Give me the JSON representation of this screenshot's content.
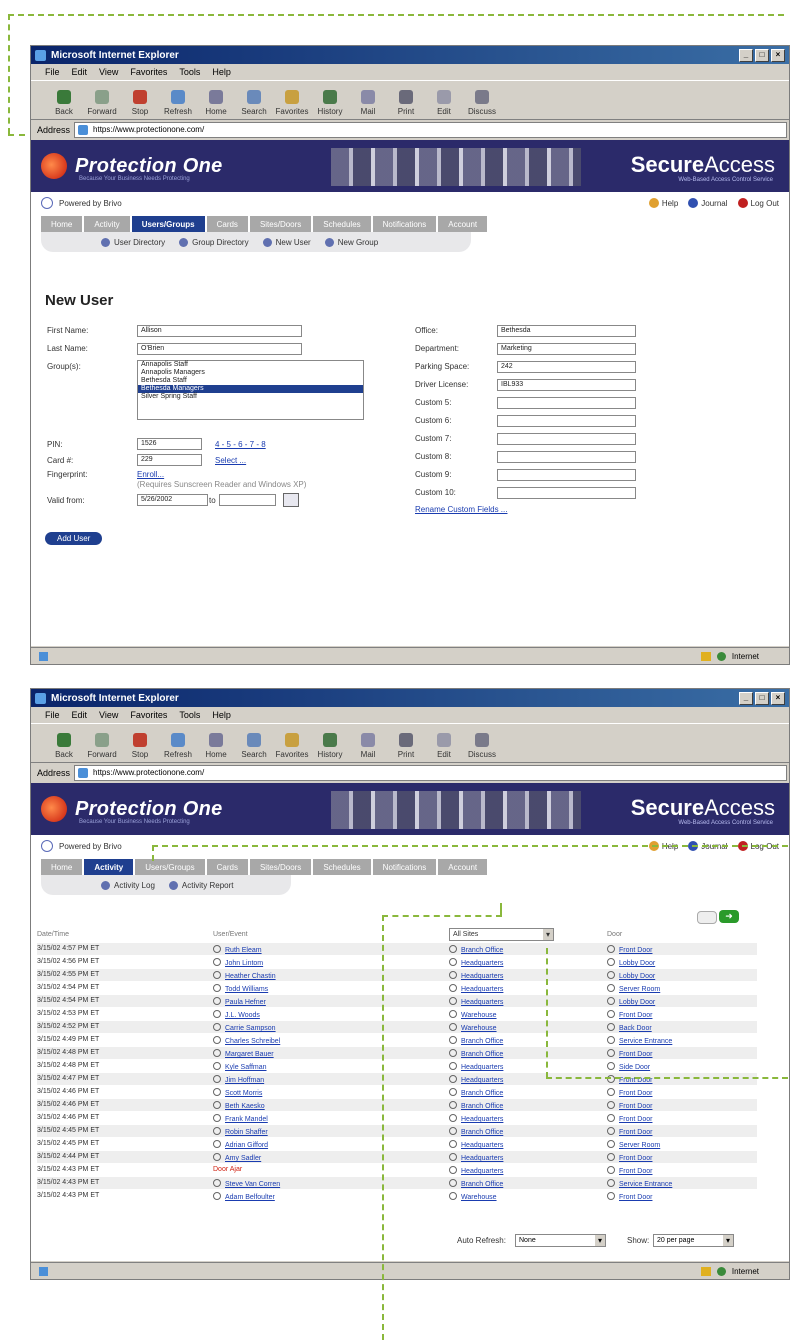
{
  "accent": "#8ab83c",
  "browser": {
    "title": "Microsoft Internet Explorer",
    "menu": [
      "File",
      "Edit",
      "View",
      "Favorites",
      "Tools",
      "Help"
    ],
    "toolbar": [
      "Back",
      "Forward",
      "Stop",
      "Refresh",
      "Home",
      "Search",
      "Favorites",
      "History",
      "Mail",
      "Print",
      "Edit",
      "Discuss"
    ],
    "address_label": "Address",
    "url_top": "https://www.protectionone.com/",
    "url_bottom": "https://www.protectionone.com/",
    "status_zone": "Internet"
  },
  "banner": {
    "brand": "Protection One",
    "tagline": "Because Your Business Needs Protecting",
    "product_bold": "Secure",
    "product_rest": "Access",
    "product_sub": "Web-Based Access Control Service"
  },
  "powered_by": "Powered by Brivo",
  "util": {
    "help": "Help",
    "journal": "Journal",
    "logout": "Log Out"
  },
  "tabs": [
    "Home",
    "Activity",
    "Users/Groups",
    "Cards",
    "Sites/Doors",
    "Schedules",
    "Notifications",
    "Account"
  ],
  "users_subnav": [
    "User Directory",
    "Group Directory",
    "New User",
    "New Group"
  ],
  "activity_subnav": [
    "Activity Log",
    "Activity Report"
  ],
  "new_user": {
    "heading": "New User",
    "first_name_label": "First Name:",
    "first_name": "Allison",
    "last_name_label": "Last Name:",
    "last_name": "O'Brien",
    "groups_label": "Group(s):",
    "groups": [
      "Annapolis Staff",
      "Annapolis Managers",
      "Bethesda Staff",
      "Bethesda Managers",
      "Silver Spring Staff"
    ],
    "selected_group": "Bethesda Managers",
    "pin_label": "PIN:",
    "pin": "1526",
    "pin_links": "4 - 5 - 6 - 7 - 8",
    "card_label": "Card #:",
    "card": "229",
    "card_link": "Select ...",
    "fingerprint_label": "Fingerprint:",
    "fingerprint_link": "Enroll...",
    "fingerprint_note": "(Requires Sunscreen Reader and Windows XP)",
    "valid_from_label": "Valid from:",
    "valid_from": "5/26/2002",
    "valid_to_label": "to",
    "office_label": "Office:",
    "office": "Bethesda",
    "department_label": "Department:",
    "department": "Marketing",
    "parking_label": "Parking Space:",
    "parking": "242",
    "license_label": "Driver License:",
    "license": "IBL933",
    "custom_labels": [
      "Custom 5:",
      "Custom 6:",
      "Custom 7:",
      "Custom 8:",
      "Custom 9:",
      "Custom 10:"
    ],
    "rename_link": "Rename Custom Fields ...",
    "add_button": "Add User"
  },
  "activity": {
    "col_datetime": "Date/Time",
    "col_user": "User/Event",
    "col_site_filter": "All Sites",
    "col_door": "Door",
    "rows": [
      {
        "dt": "3/15/02 4:57 PM ET",
        "user": "Ruth Eleam",
        "site": "Branch Office",
        "door": "Front Door"
      },
      {
        "dt": "3/15/02 4:56 PM ET",
        "user": "John Lintom",
        "site": "Headquarters",
        "door": "Lobby Door"
      },
      {
        "dt": "3/15/02 4:55 PM ET",
        "user": "Heather Chastin",
        "site": "Headquarters",
        "door": "Lobby Door"
      },
      {
        "dt": "3/15/02 4:54 PM ET",
        "user": "Todd Williams",
        "site": "Headquarters",
        "door": "Server Room"
      },
      {
        "dt": "3/15/02 4:54 PM ET",
        "user": "Paula Hefner",
        "site": "Headquarters",
        "door": "Lobby Door"
      },
      {
        "dt": "3/15/02 4:53 PM ET",
        "user": "J.L. Woods",
        "site": "Warehouse",
        "door": "Front Door"
      },
      {
        "dt": "3/15/02 4:52 PM ET",
        "user": "Carrie Sampson",
        "site": "Warehouse",
        "door": "Back Door"
      },
      {
        "dt": "3/15/02 4:49 PM ET",
        "user": "Charles Schreibel",
        "site": "Branch Office",
        "door": "Service Entrance"
      },
      {
        "dt": "3/15/02 4:48 PM ET",
        "user": "Margaret Bauer",
        "site": "Branch Office",
        "door": "Front Door"
      },
      {
        "dt": "3/15/02 4:48 PM ET",
        "user": "Kyle Saffman",
        "site": "Headquarters",
        "door": "Side Door"
      },
      {
        "dt": "3/15/02 4:47 PM ET",
        "user": "Jim Hoffman",
        "site": "Headquarters",
        "door": "Front Door"
      },
      {
        "dt": "3/15/02 4:46 PM ET",
        "user": "Scott Morris",
        "site": "Branch Office",
        "door": "Front Door"
      },
      {
        "dt": "3/15/02 4:46 PM ET",
        "user": "Beth Kaesko",
        "site": "Branch Office",
        "door": "Front Door"
      },
      {
        "dt": "3/15/02 4:46 PM ET",
        "user": "Frank Mandel",
        "site": "Headquarters",
        "door": "Front Door"
      },
      {
        "dt": "3/15/02 4:45 PM ET",
        "user": "Robin Shaffer",
        "site": "Branch Office",
        "door": "Front Door"
      },
      {
        "dt": "3/15/02 4:45 PM ET",
        "user": "Adrian Gifford",
        "site": "Headquarters",
        "door": "Server Room"
      },
      {
        "dt": "3/15/02 4:44 PM ET",
        "user": "Amy Sadler",
        "site": "Headquarters",
        "door": "Front Door"
      },
      {
        "dt": "3/15/02 4:43 PM ET",
        "user": "Door Ajar",
        "site": "Headquarters",
        "door": "Front Door",
        "alert": true
      },
      {
        "dt": "3/15/02 4:43 PM ET",
        "user": "Steve Van Corren",
        "site": "Branch Office",
        "door": "Service Entrance"
      },
      {
        "dt": "3/15/02 4:43 PM ET",
        "user": "Adam Belfoulter",
        "site": "Warehouse",
        "door": "Front Door"
      }
    ],
    "auto_refresh_label": "Auto Refresh:",
    "auto_refresh": "None",
    "show_label": "Show:",
    "show": "20 per page"
  }
}
